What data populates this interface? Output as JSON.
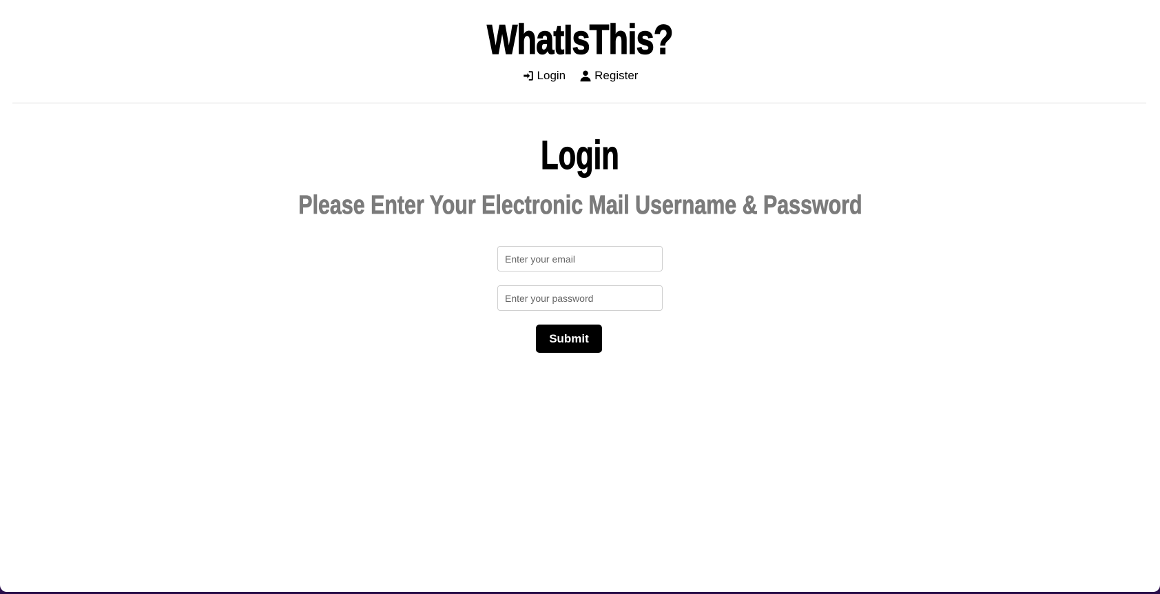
{
  "site": {
    "title": "WhatIsThis?"
  },
  "nav": {
    "items": [
      {
        "label": "Login",
        "icon": "sign-in-icon"
      },
      {
        "label": "Register",
        "icon": "user-icon"
      }
    ]
  },
  "main": {
    "heading": "Login",
    "subheading": "Please Enter Your Electronic Mail Username & Password"
  },
  "form": {
    "email_placeholder": "Enter your email",
    "password_placeholder": "Enter your password",
    "submit_label": "Submit"
  },
  "colors": {
    "text": "#000000",
    "subheading": "#7b7b7b",
    "button_bg": "#000000",
    "button_text": "#ffffff",
    "divider": "#dddddd",
    "background_edge": "#2a0d4a"
  }
}
